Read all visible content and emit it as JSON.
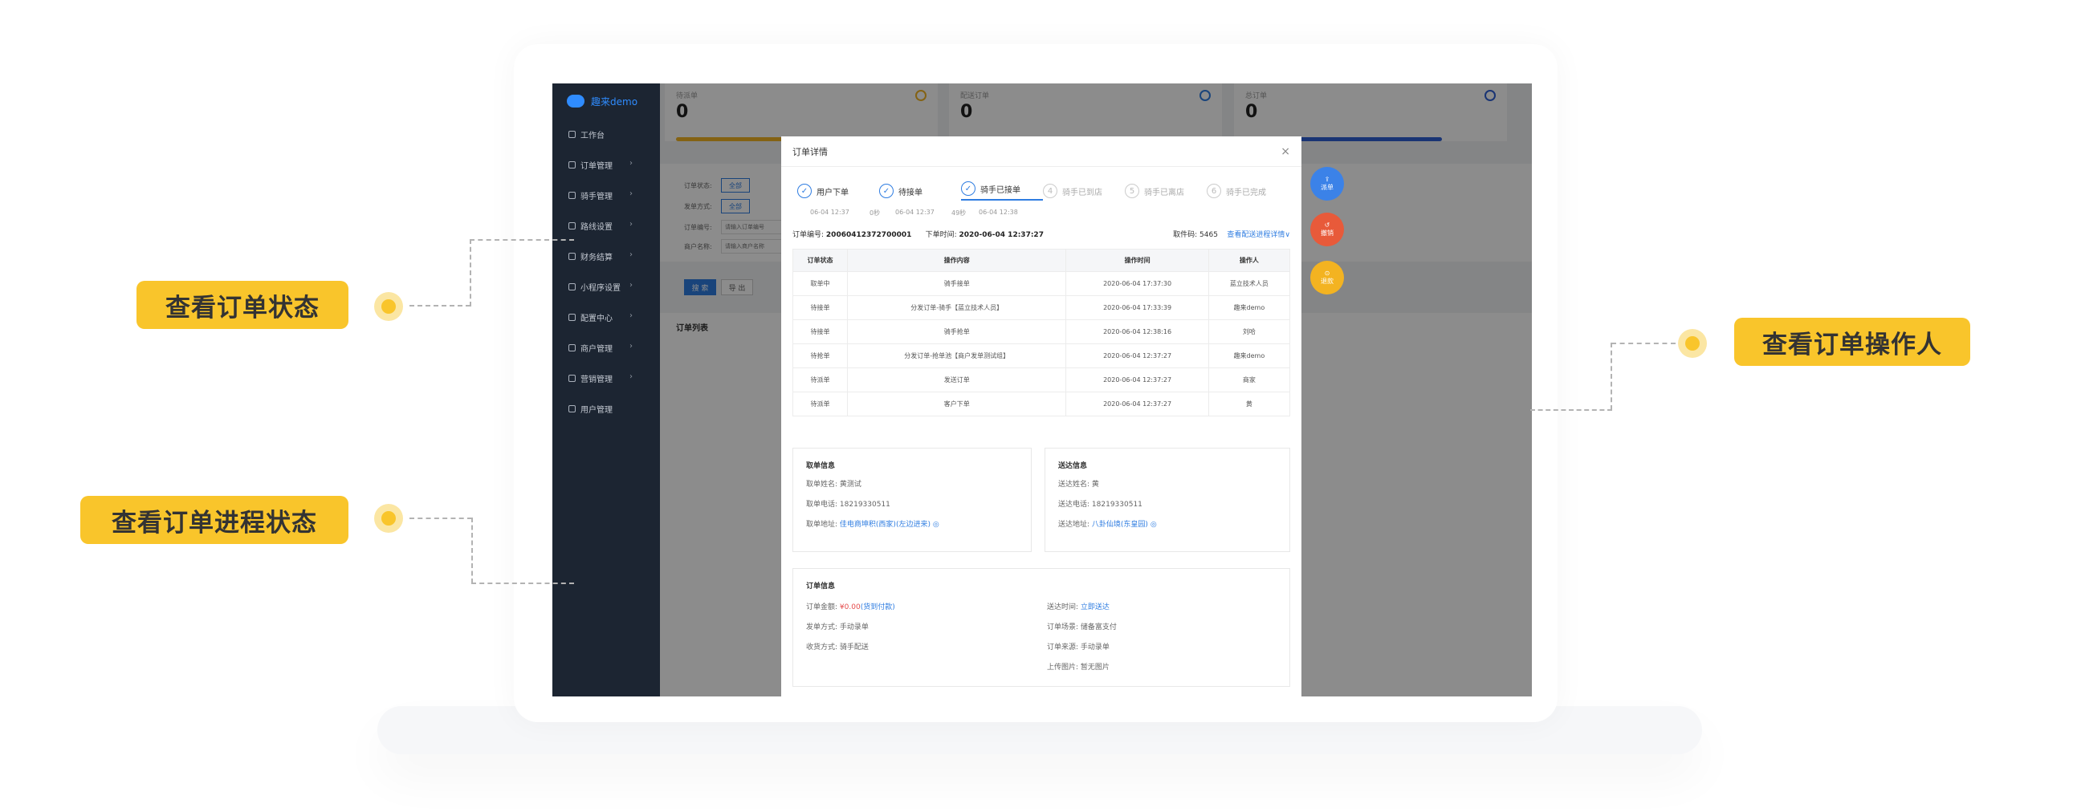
{
  "app": {
    "brand": "趣来demo",
    "nav": [
      "工作台",
      "订单管理",
      "骑手管理",
      "路线设置",
      "财务结算",
      "小程序设置",
      "配置中心",
      "商户管理",
      "营销管理",
      "用户管理"
    ]
  },
  "stats": [
    {
      "label": "待派单",
      "value": "0",
      "color": "#f0b323"
    },
    {
      "label": "配送订单",
      "value": "0",
      "color": "#2f7de1"
    },
    {
      "label": "总订单",
      "value": "0",
      "color": "#2f5fd3"
    }
  ],
  "filter": {
    "order_status_label": "订单状态:",
    "issue_mode_label": "发单方式:",
    "all": "全部",
    "order_no_label": "订单编号:",
    "order_no_placeholder": "请输入订单编号",
    "merchant_label": "商户名称:",
    "merchant_placeholder": "请输入商户名称",
    "search": "搜 索",
    "export": "导 出"
  },
  "list": {
    "title": "订单列表"
  },
  "modal": {
    "title": "订单详情",
    "steps": [
      {
        "label": "用户下单",
        "time": "06-04 12:37",
        "state": "done"
      },
      {
        "label": "待接单",
        "time": "0秒",
        "state": "done"
      },
      {
        "label": "骑手已接单",
        "time": "06-04 12:37",
        "state": "done"
      },
      {
        "label": "骑手已到店",
        "time": "49秒",
        "state": "todo",
        "num": "4"
      },
      {
        "label": "骑手已离店",
        "time": "06-04 12:38",
        "state": "todo",
        "num": "5"
      },
      {
        "label": "骑手已完成",
        "time": "",
        "state": "todo",
        "num": "6"
      }
    ],
    "order_no_label": "订单编号:",
    "order_no": "20060412372700001",
    "order_time_label": "下单时间:",
    "order_time": "2020-06-04 12:37:27",
    "pickup_code_label": "取件码:",
    "pickup_code": "5465",
    "progress_link": "查看配送进程详情∨",
    "table_headers": [
      "订单状态",
      "操作内容",
      "操作时间",
      "操作人"
    ],
    "rows": [
      [
        "取单中",
        "骑手接单",
        "2020-06-04 17:37:30",
        "蓝立技术人员"
      ],
      [
        "待接单",
        "分发订单-骑手【蓝立技术人员】",
        "2020-06-04 17:33:39",
        "趣来demo"
      ],
      [
        "待接单",
        "骑手抢单",
        "2020-06-04 12:38:16",
        "刘哈"
      ],
      [
        "待抢单",
        "分发订单-抢单池【商户发单测试组】",
        "2020-06-04 12:37:27",
        "趣来demo"
      ],
      [
        "待派单",
        "发送订单",
        "2020-06-04 12:37:27",
        "商家"
      ],
      [
        "待派单",
        "客户下单",
        "2020-06-04 12:37:27",
        "黄"
      ]
    ],
    "pickup": {
      "title": "取单信息",
      "name_label": "取单姓名:",
      "name": "黄测试",
      "phone_label": "取单电话:",
      "phone": "18219330511",
      "addr_label": "取单地址:",
      "addr": "佳电商坤积(西家)(左边进来)"
    },
    "delivery": {
      "title": "送达信息",
      "name_label": "送达姓名:",
      "name": "黄",
      "phone_label": "送达电话:",
      "phone": "18219330511",
      "addr_label": "送达地址:",
      "addr": "八卦仙境(东皇园)"
    },
    "order_info": {
      "title": "订单信息",
      "amount_label": "订单金额:",
      "amount": "¥0.00",
      "amount_note": "(货到付款)",
      "issue_label": "发单方式:",
      "issue": "手动录单",
      "collect_label": "收货方式:",
      "collect": "骑手配送",
      "time_label": "送达时间:",
      "time": "立即送达",
      "scene_label": "订单场景:",
      "scene": "储备富支付",
      "source_label": "订单来源:",
      "source": "手动录单",
      "pic_label": "上传图片:",
      "pic": "暂无图片"
    }
  },
  "fabs": [
    {
      "label": "派单",
      "color": "#3b82e8"
    },
    {
      "label": "撤销",
      "color": "#e85a3a"
    },
    {
      "label": "退款",
      "color": "#f3b321"
    }
  ],
  "callouts": {
    "status": "查看订单状态",
    "progress": "查看订单进程状态",
    "operator": "查看订单操作人"
  }
}
